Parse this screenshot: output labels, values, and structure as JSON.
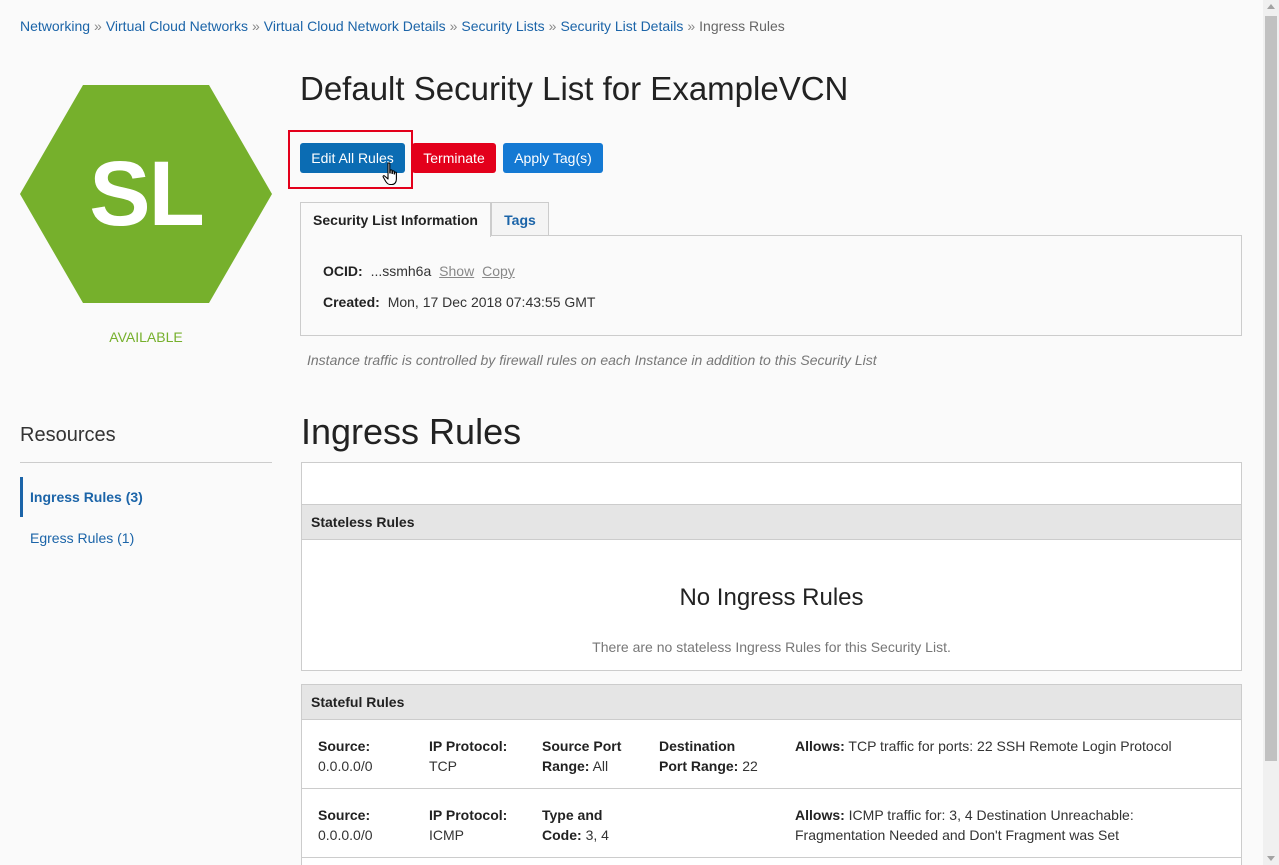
{
  "breadcrumb": {
    "items": [
      "Networking",
      "Virtual Cloud Networks",
      "Virtual Cloud Network Details",
      "Security Lists",
      "Security List Details"
    ],
    "separator": "»",
    "current": "Ingress Rules"
  },
  "resource_icon": {
    "initials": "SL",
    "color": "#76b02c",
    "status": "AVAILABLE"
  },
  "page_title": "Default Security List for ExampleVCN",
  "actions": {
    "edit_label": "Edit All Rules",
    "terminate_label": "Terminate",
    "apply_tags_label": "Apply Tag(s)"
  },
  "tabs": {
    "info": "Security List Information",
    "tags": "Tags"
  },
  "info": {
    "ocid_label": "OCID:",
    "ocid_value": "...ssmh6a",
    "show_label": "Show",
    "copy_label": "Copy",
    "created_label": "Created:",
    "created_value": "Mon, 17 Dec 2018 07:43:55 GMT"
  },
  "note": "Instance traffic is controlled by firewall rules on each Instance in addition to this Security List",
  "resources": {
    "title": "Resources",
    "items": [
      {
        "label": "Ingress Rules (3)",
        "active": true
      },
      {
        "label": "Egress Rules (1)",
        "active": false
      }
    ]
  },
  "section_title": "Ingress Rules",
  "stateless": {
    "header": "Stateless Rules",
    "empty_title": "No Ingress Rules",
    "empty_text": "There are no stateless Ingress Rules for this Security List."
  },
  "stateful": {
    "header": "Stateful Rules",
    "rules": [
      {
        "source_label": "Source:",
        "source": "0.0.0.0/0",
        "protocol_label": "IP Protocol:",
        "protocol": "TCP",
        "c3_label_1": "Source Port",
        "c3_label_2": "Range:",
        "c3_value": "All",
        "c4_label_1": "Destination",
        "c4_label_2": "Port Range:",
        "c4_value": "22",
        "allows_label": "Allows:",
        "allows_1": "TCP traffic for ports: 22 SSH Remote Login Protocol",
        "allows_2": ""
      },
      {
        "source_label": "Source:",
        "source": "0.0.0.0/0",
        "protocol_label": "IP Protocol:",
        "protocol": "ICMP",
        "c3_label_1": "Type and",
        "c3_label_2": "Code:",
        "c3_value": "3, 4",
        "allows_label": "Allows:",
        "allows_1": "ICMP traffic for: 3, 4 Destination Unreachable:",
        "allows_2": "Fragmentation Needed and Don't Fragment was Set"
      }
    ]
  },
  "colors": {
    "link": "#1b64a8",
    "primary_button": "#0b6cb3",
    "danger_button": "#e3001b",
    "tag_button": "#1479d3",
    "status_green": "#76b02c"
  }
}
